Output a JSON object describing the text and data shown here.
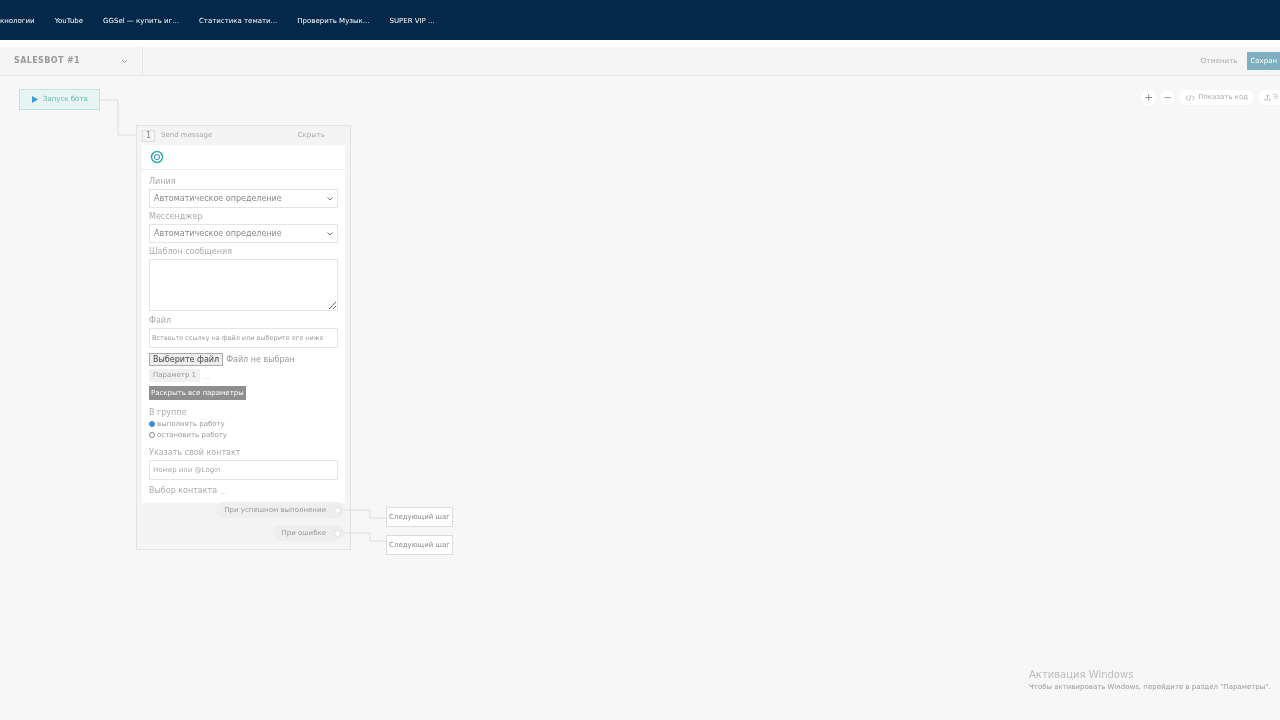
{
  "bookmarks": [
    "кнологии",
    "YouTube",
    "GGSel — купить иг...",
    "Статистика темати...",
    "Проверить Музык...",
    "SUPER VIP ..."
  ],
  "header": {
    "bot_name": "SALESBOT #1",
    "cancel": "Отменить",
    "save": "Сохран"
  },
  "toolbar": {
    "zoom_in": "+",
    "zoom_out": "−",
    "show_code": "Показать код",
    "export": "Э"
  },
  "start_node": {
    "label": "Запуск бота"
  },
  "step": {
    "number": "1",
    "title": "Send message",
    "hide": "Скрыть",
    "line": {
      "label": "Линия",
      "value": "Автоматическое определение"
    },
    "messenger": {
      "label": "Мессенджер",
      "value": "Автоматическое определение"
    },
    "template": {
      "label": "Шаблон сообщения"
    },
    "file": {
      "label": "Файл",
      "placeholder": "Вставьте ссылку на файл или выберите его ниже",
      "choose": "Выберите файл",
      "none": "Файл не выбран"
    },
    "param": {
      "label": "Параметр 1",
      "more": "..."
    },
    "expand": "Раскрыть все параметры",
    "group": {
      "label": "В группе",
      "options": [
        {
          "label": "выполнять работу",
          "selected": true
        },
        {
          "label": "остановить работу",
          "selected": false
        }
      ]
    },
    "contact": {
      "label": "Указать свой контакт",
      "placeholder": "Номер или @Login"
    },
    "contact_choice": {
      "label": "Выбор контакта",
      "more": "..."
    },
    "outputs": [
      {
        "label": "При успешном выполнении",
        "next": "Следующий шаг"
      },
      {
        "label": "При ошибке",
        "next": "Следующий шаг"
      }
    ]
  },
  "activation": {
    "title": "Активация Windows",
    "text": "Чтобы активировать Windows, перейдите в раздел \"Параметры\"."
  }
}
